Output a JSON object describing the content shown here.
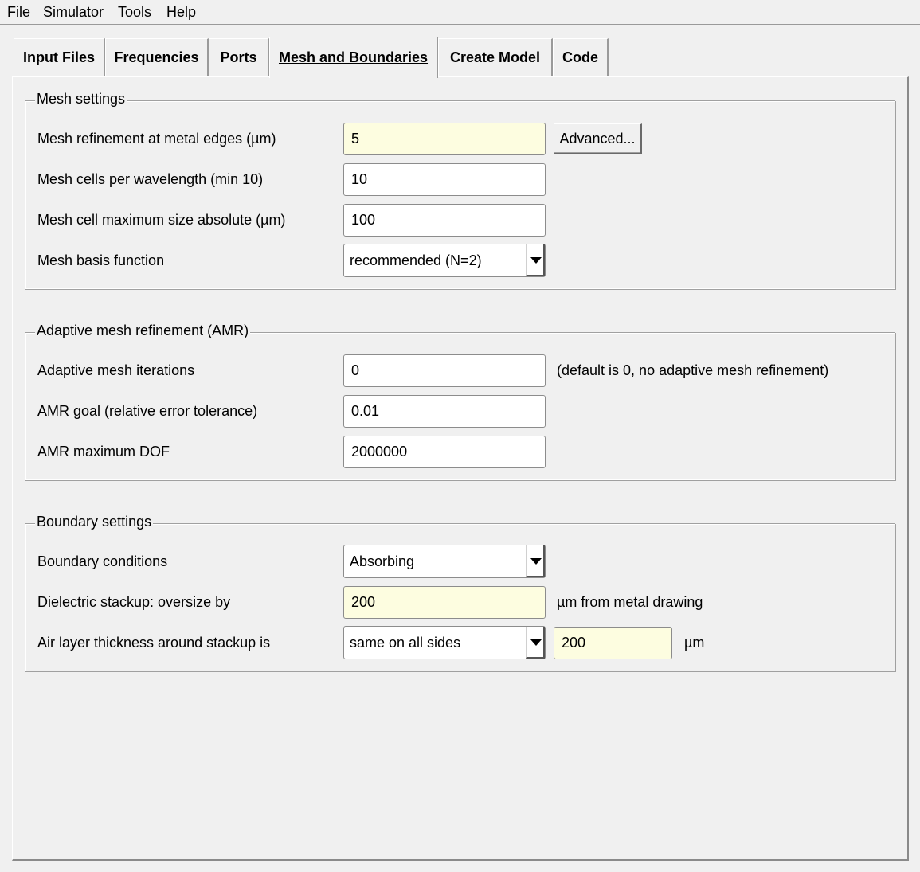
{
  "menu": {
    "file": "File",
    "simulator": "Simulator",
    "tools": "Tools",
    "help": "Help"
  },
  "tabs": [
    "Input Files",
    "Frequencies",
    "Ports",
    "Mesh and Boundaries",
    "Create Model",
    "Code"
  ],
  "mesh": {
    "title": "Mesh settings",
    "refinement_label": "Mesh refinement at metal edges (µm)",
    "refinement_value": "5",
    "advanced_label": "Advanced...",
    "cells_label": "Mesh cells per wavelength (min 10)",
    "cells_value": "10",
    "maxsize_label": "Mesh cell maximum size absolute (µm)",
    "maxsize_value": "100",
    "basis_label": "Mesh basis function",
    "basis_value": "recommended (N=2)"
  },
  "amr": {
    "title": "Adaptive mesh refinement (AMR)",
    "iterations_label": "Adaptive mesh iterations",
    "iterations_value": "0",
    "iterations_note": "(default is 0, no adaptive mesh refinement)",
    "goal_label": "AMR goal (relative error tolerance)",
    "goal_value": "0.01",
    "dof_label": "AMR maximum DOF",
    "dof_value": "2000000"
  },
  "boundary": {
    "title": "Boundary settings",
    "conditions_label": "Boundary conditions",
    "conditions_value": "Absorbing",
    "oversize_label": "Dielectric stackup: oversize by",
    "oversize_value": "200",
    "oversize_note": "µm from metal drawing",
    "air_label": "Air layer thickness around stackup is",
    "air_mode_value": "same on all sides",
    "air_value": "200",
    "air_unit": "µm"
  }
}
